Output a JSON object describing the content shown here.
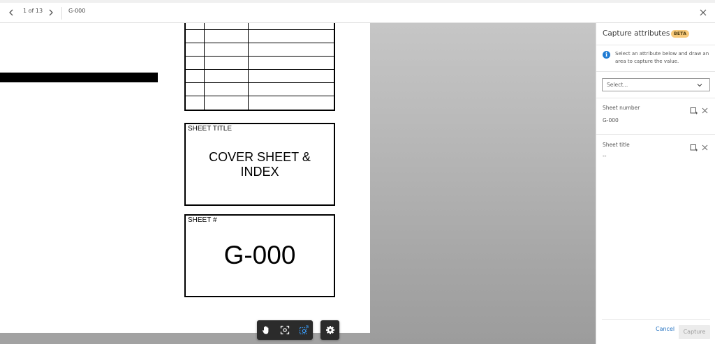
{
  "topbar": {
    "page_indicator": "1 of 13",
    "sheet_name": "G-000"
  },
  "drawing": {
    "title_box_label": "SHEET TITLE",
    "title_line1": "COVER SHEET &",
    "title_line2": "INDEX",
    "number_box_label": "SHEET #",
    "sheet_number": "G-000"
  },
  "toolbar": {
    "tools": [
      "hand-icon",
      "fit-to-view-icon",
      "area-capture-icon",
      "settings-icon"
    ]
  },
  "panel": {
    "title": "Capture attributes",
    "badge": "BETA",
    "info_text": "Select an attribute below and draw an area to capture the value.",
    "select_placeholder": "Select...",
    "attributes": [
      {
        "label": "Sheet number",
        "value": "G-000"
      },
      {
        "label": "Sheet title",
        "value": "--"
      }
    ],
    "cancel_label": "Cancel",
    "capture_label": "Capture"
  },
  "colors": {
    "accent": "#1f7bd3",
    "badge_bg": "#f7c97a",
    "toolbar_bg": "#2b2b2b"
  }
}
